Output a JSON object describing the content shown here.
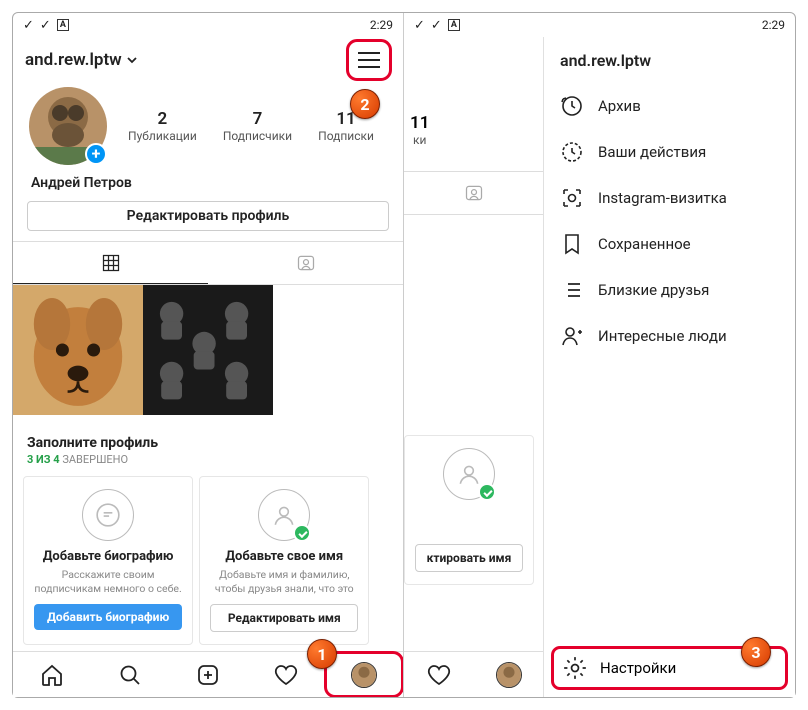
{
  "status": {
    "time": "2:29"
  },
  "profile": {
    "username": "and.rew.lptw",
    "displayName": "Андрей Петров",
    "editButton": "Редактировать профиль",
    "stats": {
      "posts": {
        "n": "2",
        "l": "Публикации"
      },
      "followers": {
        "n": "7",
        "l": "Подписчики"
      },
      "following": {
        "n": "11",
        "l": "Подписки"
      }
    }
  },
  "complete": {
    "title": "Заполните профиль",
    "done": "3 ИЗ 4",
    "suffix": "ЗАВЕРШЕНО",
    "cards": [
      {
        "title": "Добавьте биографию",
        "desc": "Расскажите своим подписчикам немного о себе.",
        "btn": "Добавить биографию"
      },
      {
        "title": "Добавьте свое имя",
        "desc": "Добавьте имя и фамилию, чтобы друзья знали, что это",
        "btn": "Редактировать имя"
      }
    ]
  },
  "menu": {
    "title": "and.rew.lptw",
    "items": [
      "Архив",
      "Ваши действия",
      "Instagram-визитка",
      "Сохраненное",
      "Близкие друзья",
      "Интересные люди"
    ],
    "settings": "Настройки"
  },
  "card2_trunc_btn": "ктировать имя",
  "stat2_trunc": "ки"
}
